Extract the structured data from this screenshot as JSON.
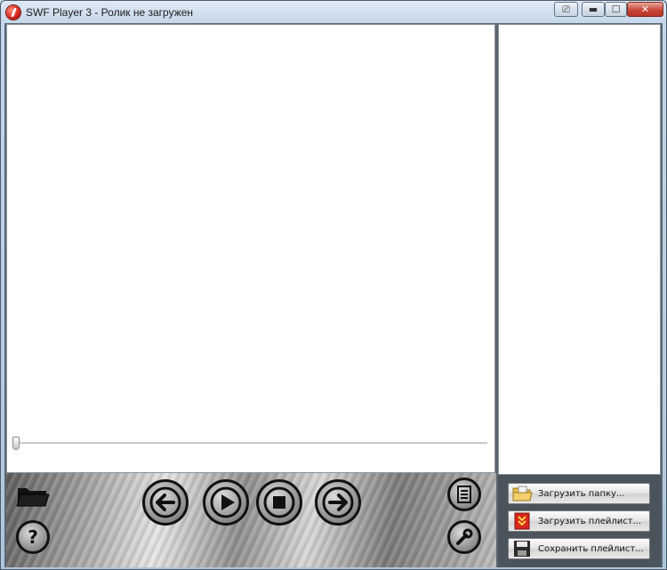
{
  "window": {
    "title": "SWF Player 3 - Ролик не загружен",
    "controls": {
      "extra": "⎚",
      "minimize": "▬",
      "maximize": "☐",
      "close": "✕"
    }
  },
  "stage": {
    "loaded": false
  },
  "seekbar": {
    "position": 0
  },
  "controls": {
    "back_icon": "arrow-left-icon",
    "play_icon": "play-icon",
    "stop_icon": "stop-icon",
    "forward_icon": "arrow-right-icon",
    "open_icon": "folder-icon",
    "help_icon": "question-icon",
    "list_icon": "playlist-icon",
    "settings_icon": "wrench-icon",
    "help_glyph": "?"
  },
  "playlist_panel": {
    "load_folder": "Загрузить папку...",
    "load_playlist": "Загрузить плейлист...",
    "save_playlist": "Сохранить плейлист..."
  },
  "colors": {
    "accent_red": "#d2231a",
    "close_button": "#c9463a",
    "panel_dark": "#4b545d"
  }
}
